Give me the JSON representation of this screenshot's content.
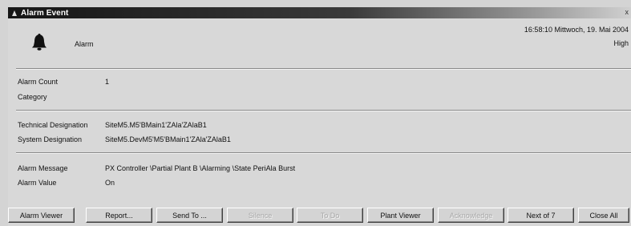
{
  "window": {
    "title": "Alarm Event",
    "close_glyph": "x"
  },
  "header": {
    "icon": "bell-icon",
    "alarm_label": "Alarm",
    "timestamp": "16:58:10 Mittwoch, 19. Mai 2004",
    "priority": "High"
  },
  "details": {
    "alarm_count_label": "Alarm Count",
    "alarm_count_value": "1",
    "category_label": "Category",
    "technical_designation_label": "Technical Designation",
    "technical_designation_value": "SiteM5.M5'BMain1'ZAla'ZAlaB1",
    "system_designation_label": "System Designation",
    "system_designation_value": "SiteM5.DevM5'M5'BMain1'ZAla'ZAlaB1",
    "alarm_message_label": "Alarm Message",
    "alarm_message_value": "PX Controller \\Partial Plant B \\Alarming \\State PeriAla Burst",
    "alarm_value_label": "Alarm Value",
    "alarm_value_value": "On"
  },
  "buttons": {
    "alarm_viewer": "Alarm Viewer",
    "report": "Report...",
    "send_to": "Send To ...",
    "silence": "Silence",
    "to_do": "To Do",
    "plant_viewer": "Plant Viewer",
    "acknowledge": "Acknowledge",
    "next": "Next of 7",
    "close_all": "Close All"
  }
}
